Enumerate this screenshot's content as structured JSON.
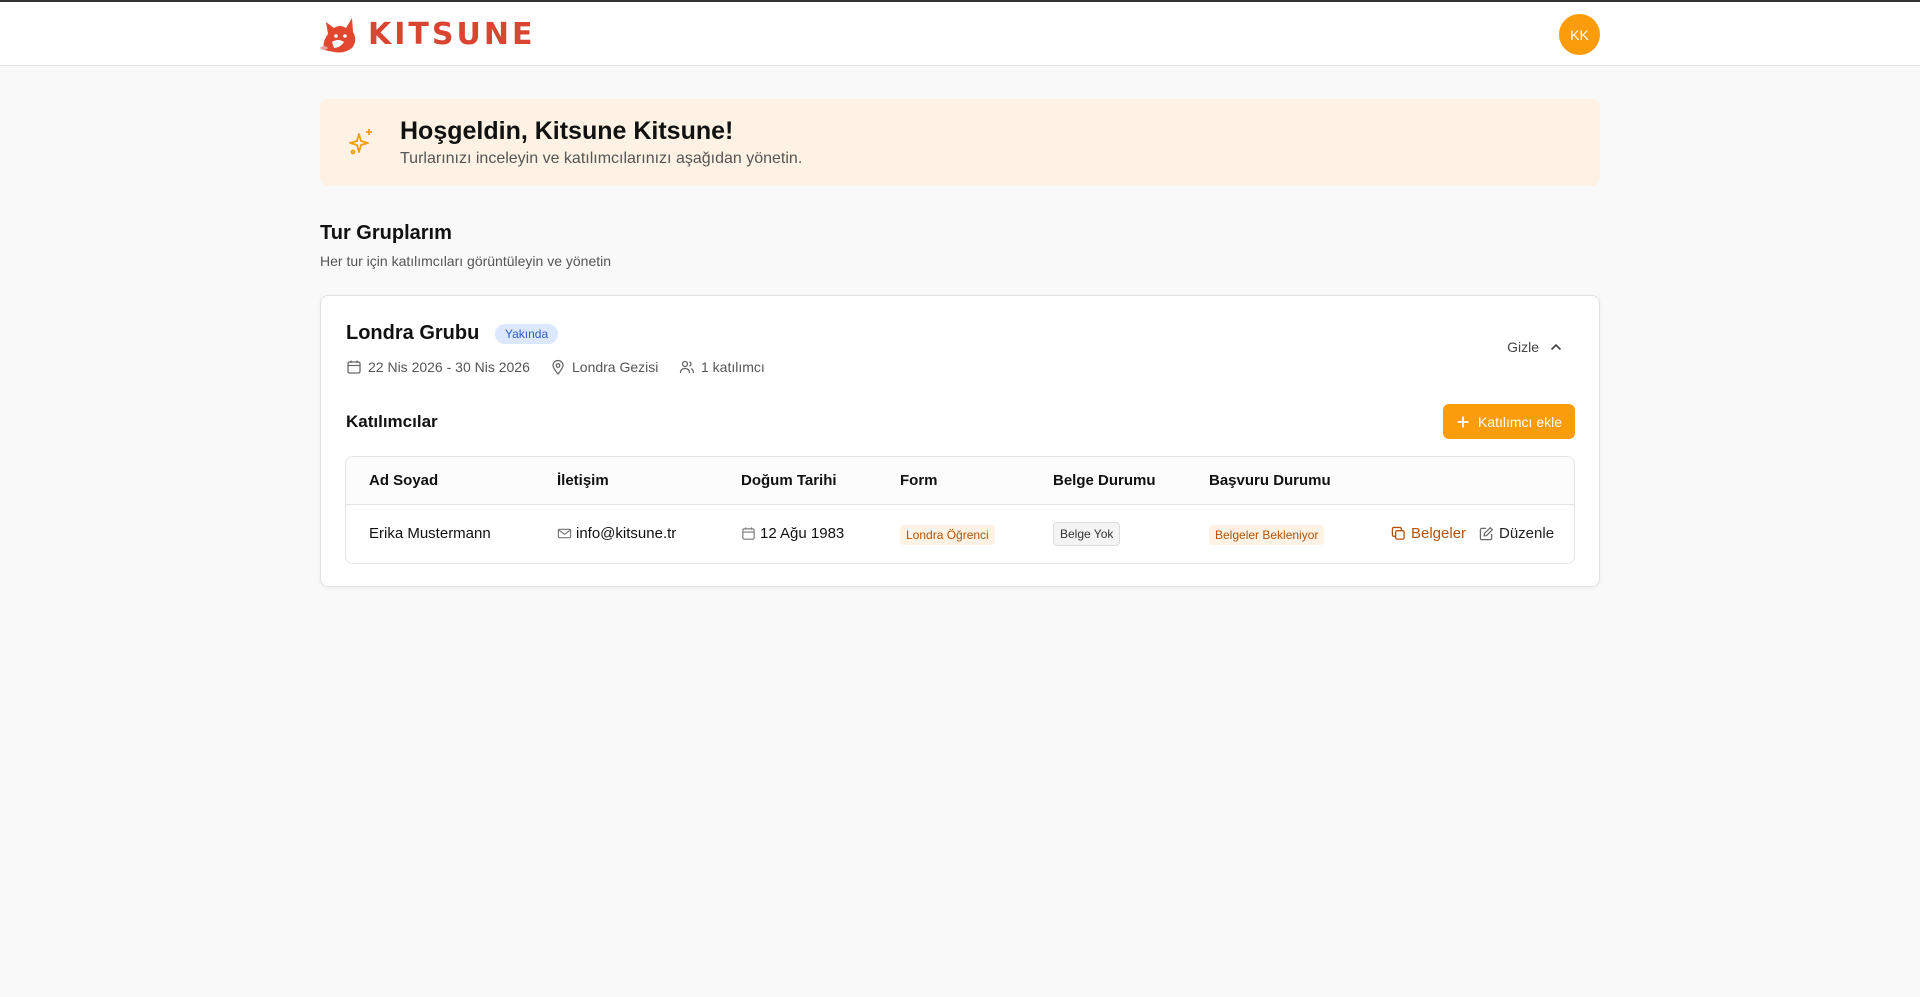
{
  "app": {
    "brand": "KITSUNE",
    "user_initials": "KK"
  },
  "welcome": {
    "title": "Hoşgeldin, Kitsune Kitsune!",
    "subtitle": "Turlarınızı inceleyin ve katılımcılarınızı aşağıdan yönetin."
  },
  "section": {
    "title": "Tur Gruplarım",
    "subtitle": "Her tur için katılımcıları görüntüleyin ve yönetin"
  },
  "group": {
    "name": "Londra Grubu",
    "status_badge": "Yakında",
    "dates": "22 Nis 2026 - 30 Nis 2026",
    "trip": "Londra Gezisi",
    "participant_count": "1 katılımcı",
    "toggle_label": "Gizle",
    "participants_title": "Katılımcılar",
    "add_button": "Katılımcı ekle"
  },
  "table": {
    "columns": [
      "Ad Soyad",
      "İletişim",
      "Doğum Tarihi",
      "Form",
      "Belge Durumu",
      "Başvuru Durumu"
    ],
    "rows": [
      {
        "name": "Erika Mustermann",
        "email": "info@kitsune.tr",
        "birth_date": "12 Ağu 1983",
        "form": "Londra Öğrenci",
        "document_status": "Belge Yok",
        "application_status": "Belgeler Bekleniyor",
        "docs_action": "Belgeler",
        "edit_action": "Düzenle"
      }
    ]
  },
  "colors": {
    "accent": "#fb9c0b",
    "brand": "#d94530",
    "welcome_bg": "#fdf2e3",
    "badge_blue_bg": "#dbe8fd",
    "badge_blue_text": "#2f5cc7"
  }
}
